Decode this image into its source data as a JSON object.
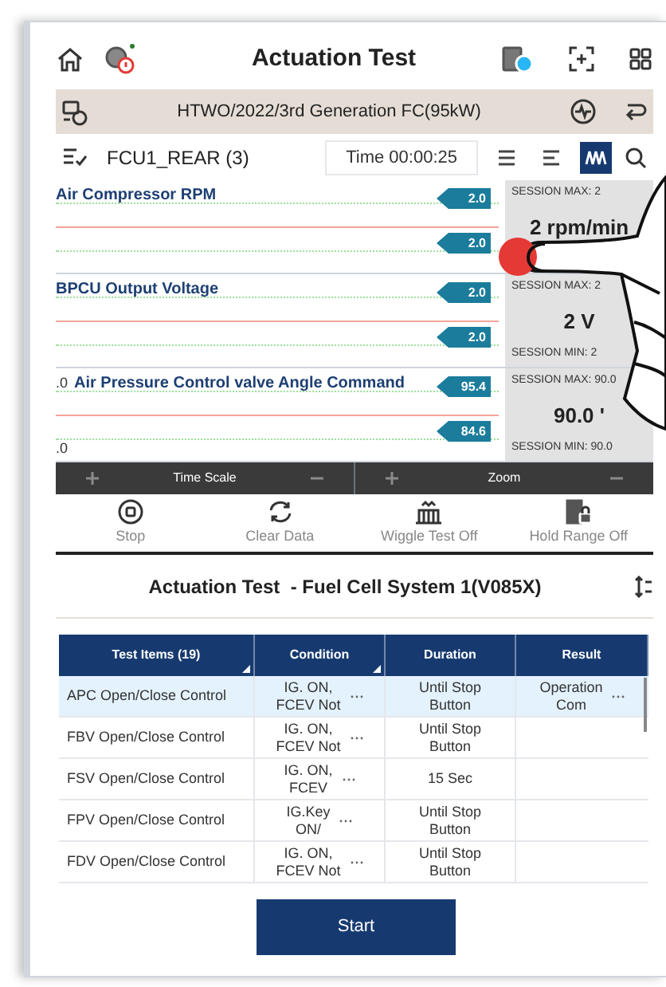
{
  "header": {
    "title": "Actuation Test"
  },
  "vehicle_bar": {
    "text": "HTWO/2022/3rd Generation FC(95kW)"
  },
  "toolbar": {
    "system": "FCU1_REAR (3)",
    "time": "Time 00:00:25",
    "view_modes": [
      {
        "kind": "list",
        "selected": false
      },
      {
        "kind": "text",
        "selected": false
      },
      {
        "kind": "graph",
        "selected": true
      }
    ]
  },
  "signals": [
    {
      "name": "Air Compressor RPM",
      "max_tag": "2.0",
      "min_tag": "2.0",
      "session_max": "SESSION MAX: 2",
      "value": "2 rpm/min"
    },
    {
      "name": "BPCU Output Voltage",
      "max_tag": "2.0",
      "min_tag": "2.0",
      "session_max": "SESSION MAX: 2",
      "value": "2 V",
      "session_min": "SESSION MIN: 2"
    },
    {
      "name": "Air Pressure Control valve Angle Command",
      "axis_top": ".0",
      "axis_bottom": ".0",
      "max_tag": "95.4",
      "min_tag": "84.6",
      "session_max": "SESSION MAX: 90.0",
      "value": "90.0 '",
      "session_min": "SESSION MIN: 90.0"
    }
  ],
  "scale_controls": [
    {
      "label": "Time Scale"
    },
    {
      "label": "Zoom"
    }
  ],
  "actions": [
    {
      "kind": "stop",
      "label": "Stop"
    },
    {
      "kind": "clear",
      "label": "Clear Data"
    },
    {
      "kind": "wiggle",
      "label": "Wiggle Test Off"
    },
    {
      "kind": "hold",
      "label": "Hold Range Off"
    }
  ],
  "test_panel": {
    "title": "Actuation Test  - Fuel Cell System 1(V085X)",
    "columns": [
      {
        "label": "Test Items (19)",
        "sortable": true
      },
      {
        "label": "Condition",
        "sortable": true
      },
      {
        "label": "Duration",
        "sortable": false
      },
      {
        "label": "Result",
        "sortable": false
      }
    ],
    "rows": [
      {
        "selected": true,
        "item": "APC Open/Close Control",
        "condition": "IG. ON,\nFCEV Not",
        "duration": "Until Stop\nButton",
        "result": "Operation\nCom"
      },
      {
        "selected": false,
        "item": "FBV Open/Close Control",
        "condition": "IG. ON,\nFCEV Not",
        "duration": "Until Stop\nButton"
      },
      {
        "selected": false,
        "item": "FSV Open/Close Control",
        "condition": "IG. ON,\nFCEV",
        "duration": "15 Sec"
      },
      {
        "selected": false,
        "item": "FPV Open/Close Control",
        "condition": "IG.Key\nON/",
        "duration": "Until Stop\nButton"
      },
      {
        "selected": false,
        "item": "FDV Open/Close Control",
        "condition": "IG. ON,\nFCEV Not",
        "duration": "Until Stop\nButton"
      }
    ]
  },
  "start_button": {
    "label": "Start"
  }
}
